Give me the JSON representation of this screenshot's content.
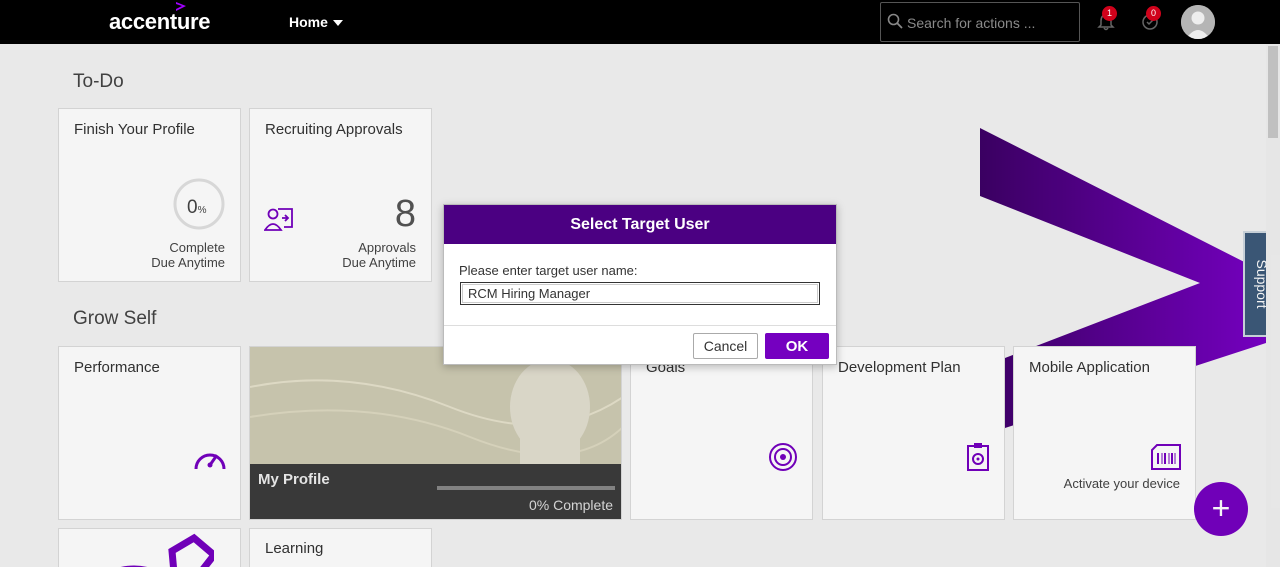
{
  "header": {
    "logo": "accenture",
    "home_label": "Home",
    "search_placeholder": "Search for actions ...",
    "notifications_count": "1",
    "approvals_count": "0"
  },
  "sections": {
    "todo": "To-Do",
    "grow_self": "Grow Self"
  },
  "tiles": {
    "finish_profile": {
      "title": "Finish Your Profile",
      "percent": "0",
      "percent_unit": "%",
      "status": "Complete",
      "due": "Due Anytime"
    },
    "recruiting": {
      "title": "Recruiting Approvals",
      "count": "8",
      "label": "Approvals",
      "due": "Due Anytime"
    },
    "performance": {
      "title": "Performance"
    },
    "my_profile": {
      "title": "My Profile",
      "progress": "0% Complete",
      "progress_value": 0
    },
    "goals": {
      "title": "Goals"
    },
    "development": {
      "title": "Development Plan"
    },
    "mobile": {
      "title": "Mobile Application",
      "subtitle": "Activate your device"
    },
    "learning": {
      "title": "Learning"
    }
  },
  "support_label": "Support",
  "dialog": {
    "title": "Select Target User",
    "label": "Please enter target user name:",
    "input_value": "RCM Hiring Manager",
    "cancel": "Cancel",
    "ok": "OK"
  },
  "colors": {
    "brand": "#7500c0",
    "dialog_header": "#4b0082",
    "header_bg": "#000000"
  }
}
